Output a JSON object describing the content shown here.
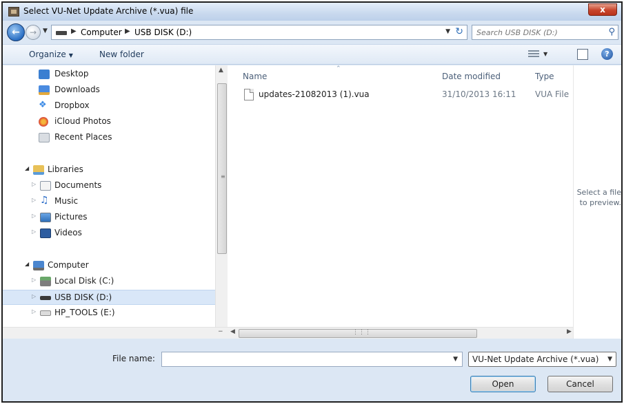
{
  "window": {
    "title": "Select VU-Net Update Archive (*.vua) file",
    "close_symbol": "x"
  },
  "address": {
    "crumbs": [
      "Computer",
      "USB DISK (D:)"
    ],
    "search_placeholder": "Search USB DISK (D:)"
  },
  "toolbar": {
    "organize": "Organize",
    "new_folder": "New folder"
  },
  "nav": {
    "items": [
      {
        "label": "Desktop",
        "icon": "desktop-icon"
      },
      {
        "label": "Downloads",
        "icon": "downloads-icon"
      },
      {
        "label": "Dropbox",
        "icon": "dropbox-icon"
      },
      {
        "label": "iCloud Photos",
        "icon": "icloud-photos-icon"
      },
      {
        "label": "Recent Places",
        "icon": "recent-places-icon"
      },
      {
        "label": "Libraries",
        "icon": "libraries-icon"
      },
      {
        "label": "Documents",
        "icon": "documents-icon"
      },
      {
        "label": "Music",
        "icon": "music-icon"
      },
      {
        "label": "Pictures",
        "icon": "pictures-icon"
      },
      {
        "label": "Videos",
        "icon": "videos-icon"
      },
      {
        "label": "Computer",
        "icon": "computer-icon"
      },
      {
        "label": "Local Disk (C:)",
        "icon": "local-disk-icon"
      },
      {
        "label": "USB DISK (D:)",
        "icon": "usb-disk-icon",
        "selected": true
      },
      {
        "label": "HP_TOOLS (E:)",
        "icon": "drive-icon"
      }
    ]
  },
  "files": {
    "columns": {
      "name": "Name",
      "date": "Date modified",
      "type": "Type"
    },
    "rows": [
      {
        "name": "updates-21082013 (1).vua",
        "date": "31/10/2013 16:11",
        "type": "VUA File"
      }
    ]
  },
  "preview": {
    "text": "Select a file to preview."
  },
  "bottom": {
    "file_name_label": "File name:",
    "file_name_value": "",
    "file_type": "VU-Net Update Archive (*.vua)",
    "open": "Open",
    "cancel": "Cancel"
  },
  "colors": {
    "accent": "#2d6db7",
    "selection": "#d9e7f8",
    "close": "#c8452c"
  }
}
